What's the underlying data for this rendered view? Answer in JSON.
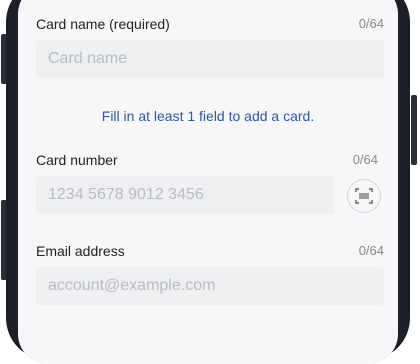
{
  "card_name": {
    "label": "Card name (required)",
    "counter": "0/64",
    "placeholder": "Card name"
  },
  "hint": "Fill in at least 1 field to add a card.",
  "card_number": {
    "label": "Card number",
    "counter": "0/64",
    "placeholder": "1234 5678 9012 3456",
    "scan_icon": "barcode-scan-icon"
  },
  "email": {
    "label": "Email address",
    "counter": "0/64",
    "placeholder": "account@example.com"
  }
}
